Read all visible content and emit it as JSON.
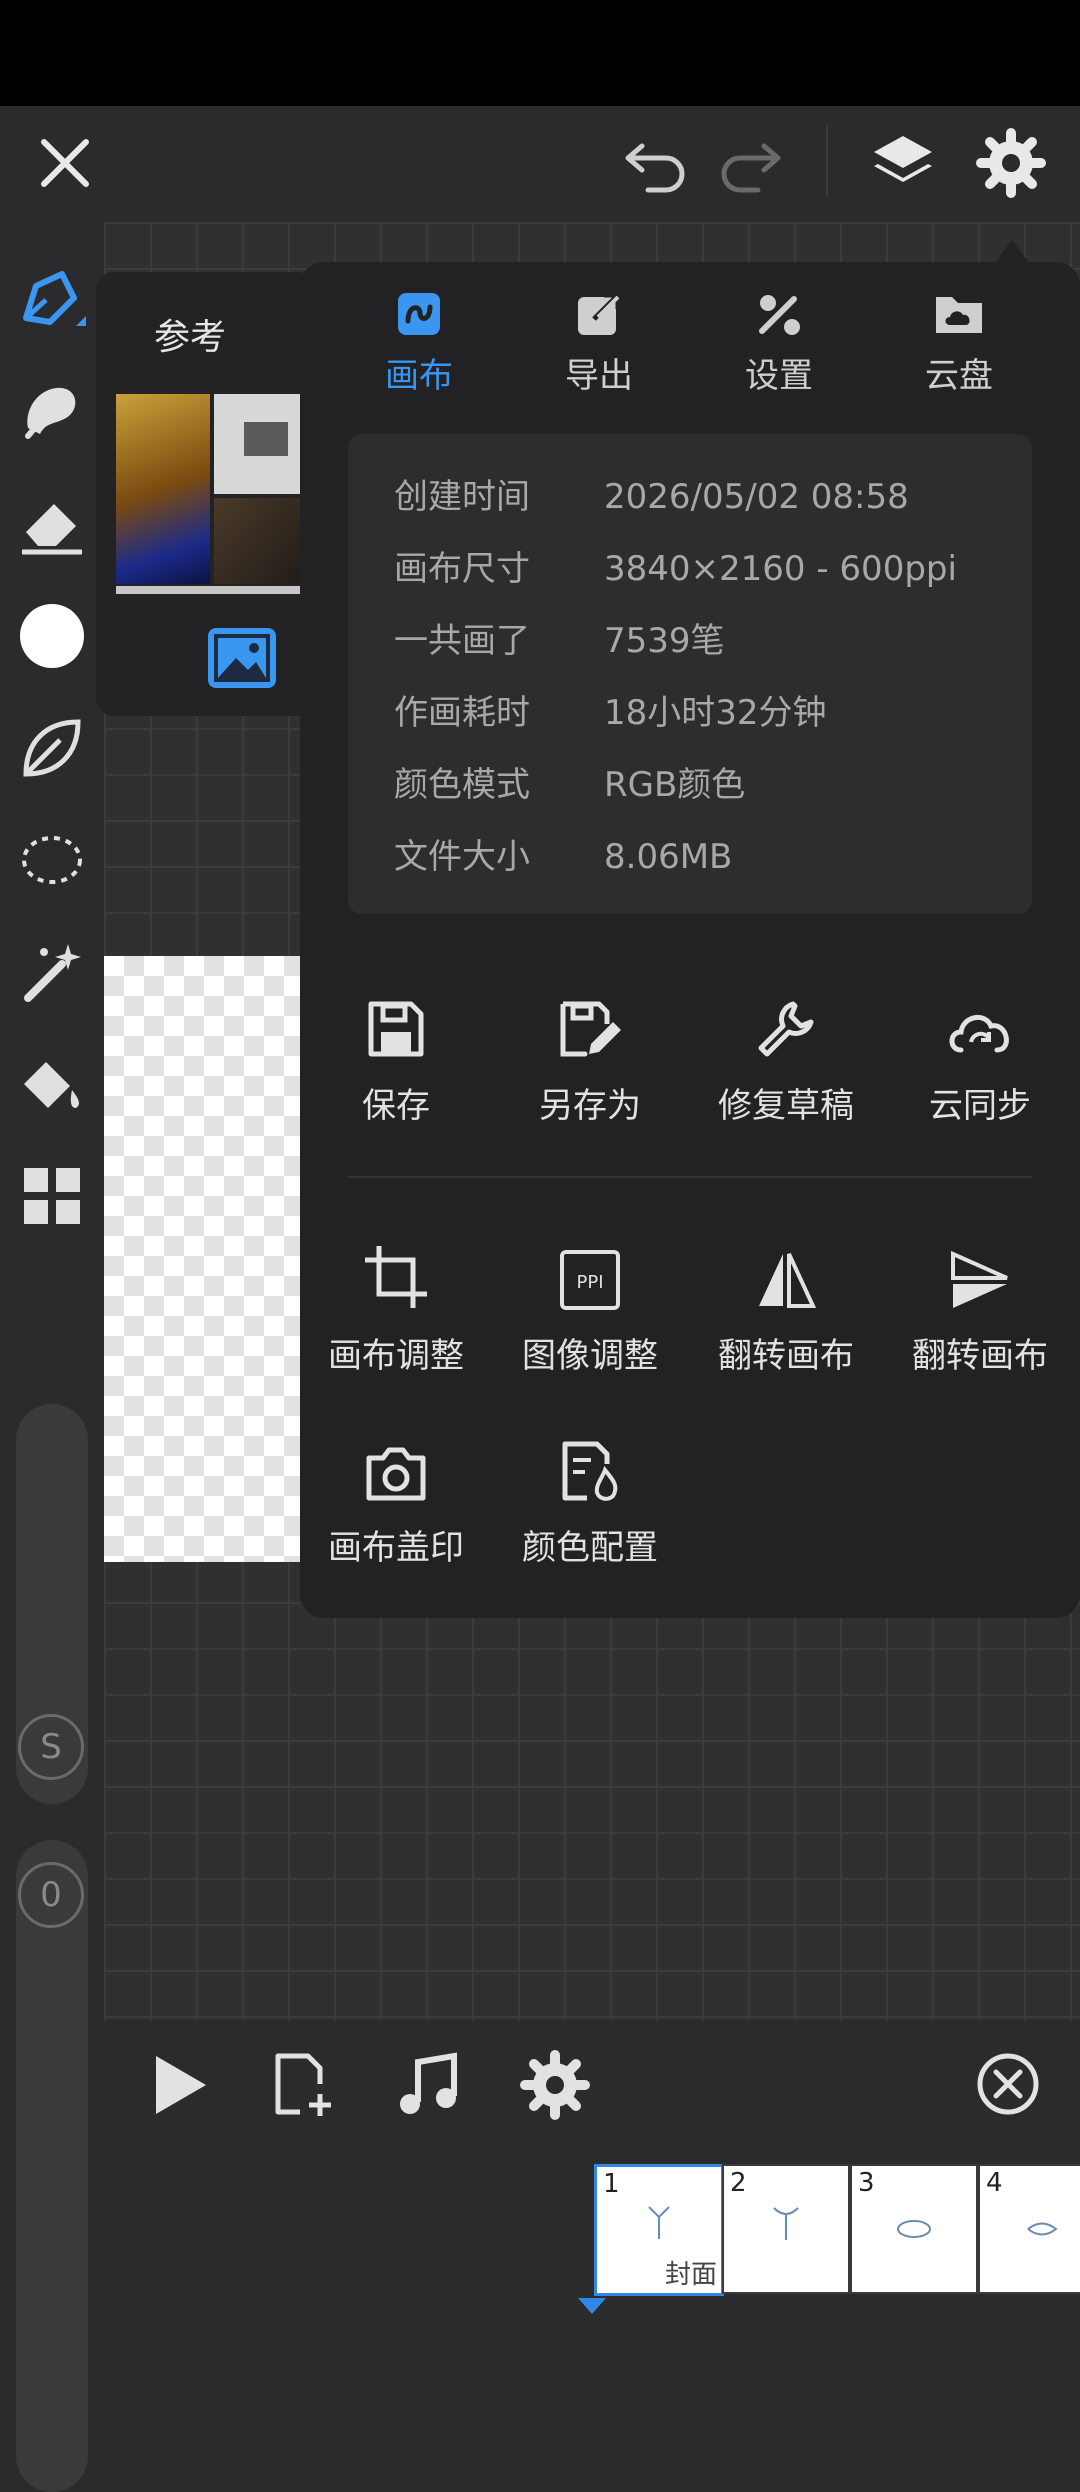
{
  "reference_panel": {
    "title": "参考"
  },
  "menu": {
    "tabs": [
      {
        "label": "画布",
        "icon": "canvas-icon",
        "active": true
      },
      {
        "label": "导出",
        "icon": "export-icon",
        "active": false
      },
      {
        "label": "设置",
        "icon": "tools-icon",
        "active": false
      },
      {
        "label": "云盘",
        "icon": "cloud-folder-icon",
        "active": false
      }
    ],
    "info": [
      {
        "key": "创建时间",
        "value": "2026/05/02 08:58"
      },
      {
        "key": "画布尺寸",
        "value": "3840×2160 - 600ppi"
      },
      {
        "key": "一共画了",
        "value": "7539笔"
      },
      {
        "key": "作画耗时",
        "value": "18小时32分钟"
      },
      {
        "key": "颜色模式",
        "value": "RGB颜色"
      },
      {
        "key": "文件大小",
        "value": "8.06MB"
      }
    ],
    "actions_row1": [
      {
        "label": "保存",
        "icon": "save-icon"
      },
      {
        "label": "另存为",
        "icon": "save-as-icon"
      },
      {
        "label": "修复草稿",
        "icon": "wrench-icon"
      },
      {
        "label": "云同步",
        "icon": "cloud-sync-icon"
      }
    ],
    "actions_row2": [
      {
        "label": "画布调整",
        "icon": "crop-icon"
      },
      {
        "label": "图像调整",
        "icon": "ppi-icon"
      },
      {
        "label": "翻转画布",
        "icon": "flip-horizontal-icon"
      },
      {
        "label": "翻转画布",
        "icon": "flip-vertical-icon"
      }
    ],
    "actions_row3": [
      {
        "label": "画布盖印",
        "icon": "camera-icon"
      },
      {
        "label": "颜色配置",
        "icon": "color-config-icon"
      }
    ]
  },
  "sliders": {
    "size_badge": "S",
    "opacity_badge": "0"
  },
  "frames": [
    {
      "number": "1",
      "caption": "封面",
      "selected": true
    },
    {
      "number": "2",
      "caption": "",
      "selected": false
    },
    {
      "number": "3",
      "caption": "",
      "selected": false
    },
    {
      "number": "4",
      "caption": "",
      "selected": false
    }
  ],
  "colors": {
    "accent": "#3a96f0",
    "panel": "#222224",
    "background": "#2b2b2d"
  }
}
